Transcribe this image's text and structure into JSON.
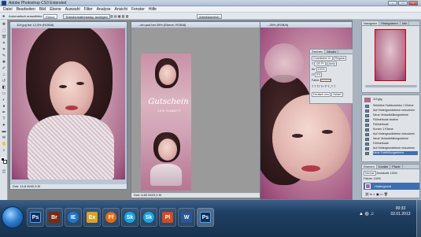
{
  "window": {
    "title": "Adobe Photoshop CS3 Extended",
    "minimize": "–",
    "maximize": "□",
    "close": "×"
  },
  "menu": [
    "Datei",
    "Bearbeiten",
    "Bild",
    "Ebene",
    "Auswahl",
    "Filter",
    "Analyse",
    "Ansicht",
    "Fenster",
    "Hilfe"
  ],
  "options": {
    "auto_select": "Automatisch auswählen:",
    "layer_select": "Ebene",
    "transform": "Transformationsstrg. anzeigen",
    "workspace": "Arbeitsbereich"
  },
  "docs": {
    "left": {
      "title": "119.jpg bei 12,5% (RGB/8)",
      "status": "Dok: 14,8 M/40,3 M"
    },
    "middle": {
      "title": "...ein.psd bei 25% (Ebene, RGB/8)",
      "status": "Dok: 6,60 M/23,3 M"
    },
    "right": {
      "title": "...25% (RGB/8)"
    }
  },
  "artwork": {
    "script_text": "Gutschein",
    "subtitle": "10% RABATT"
  },
  "char_panel": {
    "tabs": [
      "Zeichen",
      "Absatz"
    ],
    "font": "Chanticleer Ill.",
    "style": "Regular",
    "size": "120 Pt",
    "leading": "(Auto)",
    "tracking": "100%",
    "scale": "0%",
    "color_label": "Farbe:",
    "language": "Deutsch neu",
    "antialias": "Scharf"
  },
  "navigator": {
    "tabs": [
      "Navigator",
      "Histogramm",
      "Info"
    ]
  },
  "history": {
    "doc": "119.jpg",
    "items": [
      "Selektive Farbkorrektur 1 Ebene",
      "Auf Hintergrundebene reduzieren",
      "Neue Verlaufsfüllungsebene",
      "Füllmethode ändern",
      "Füllmethode",
      "Kurven 1 Ebene",
      "Auf Hintergrundebene reduzieren",
      "Neue Verlaufsfüllungsebene",
      "Füllmethode",
      "Auf Hintergrundebene reduzieren",
      "Neue Farbfüllungsebene"
    ]
  },
  "layers": {
    "tabs": [
      "Ebenen",
      "Kanäle",
      "Pfade"
    ],
    "blend_mode": "Normal",
    "opacity": "Deckkraft: 100%",
    "fill": "Fläche: 100%",
    "layer_name": "Hintergrund"
  },
  "taskbar": {
    "apps": [
      "Ps",
      "Br",
      "IE",
      "Ex",
      "Ff",
      "Sk",
      "Sk",
      "Pl",
      "W",
      "Ps"
    ],
    "clock_time": "00:33",
    "clock_date": "02.01.2013"
  },
  "colors": {
    "taskbar": "#1f3f63",
    "accent": "#2f7fd0",
    "vignette": "#b04a8a"
  }
}
